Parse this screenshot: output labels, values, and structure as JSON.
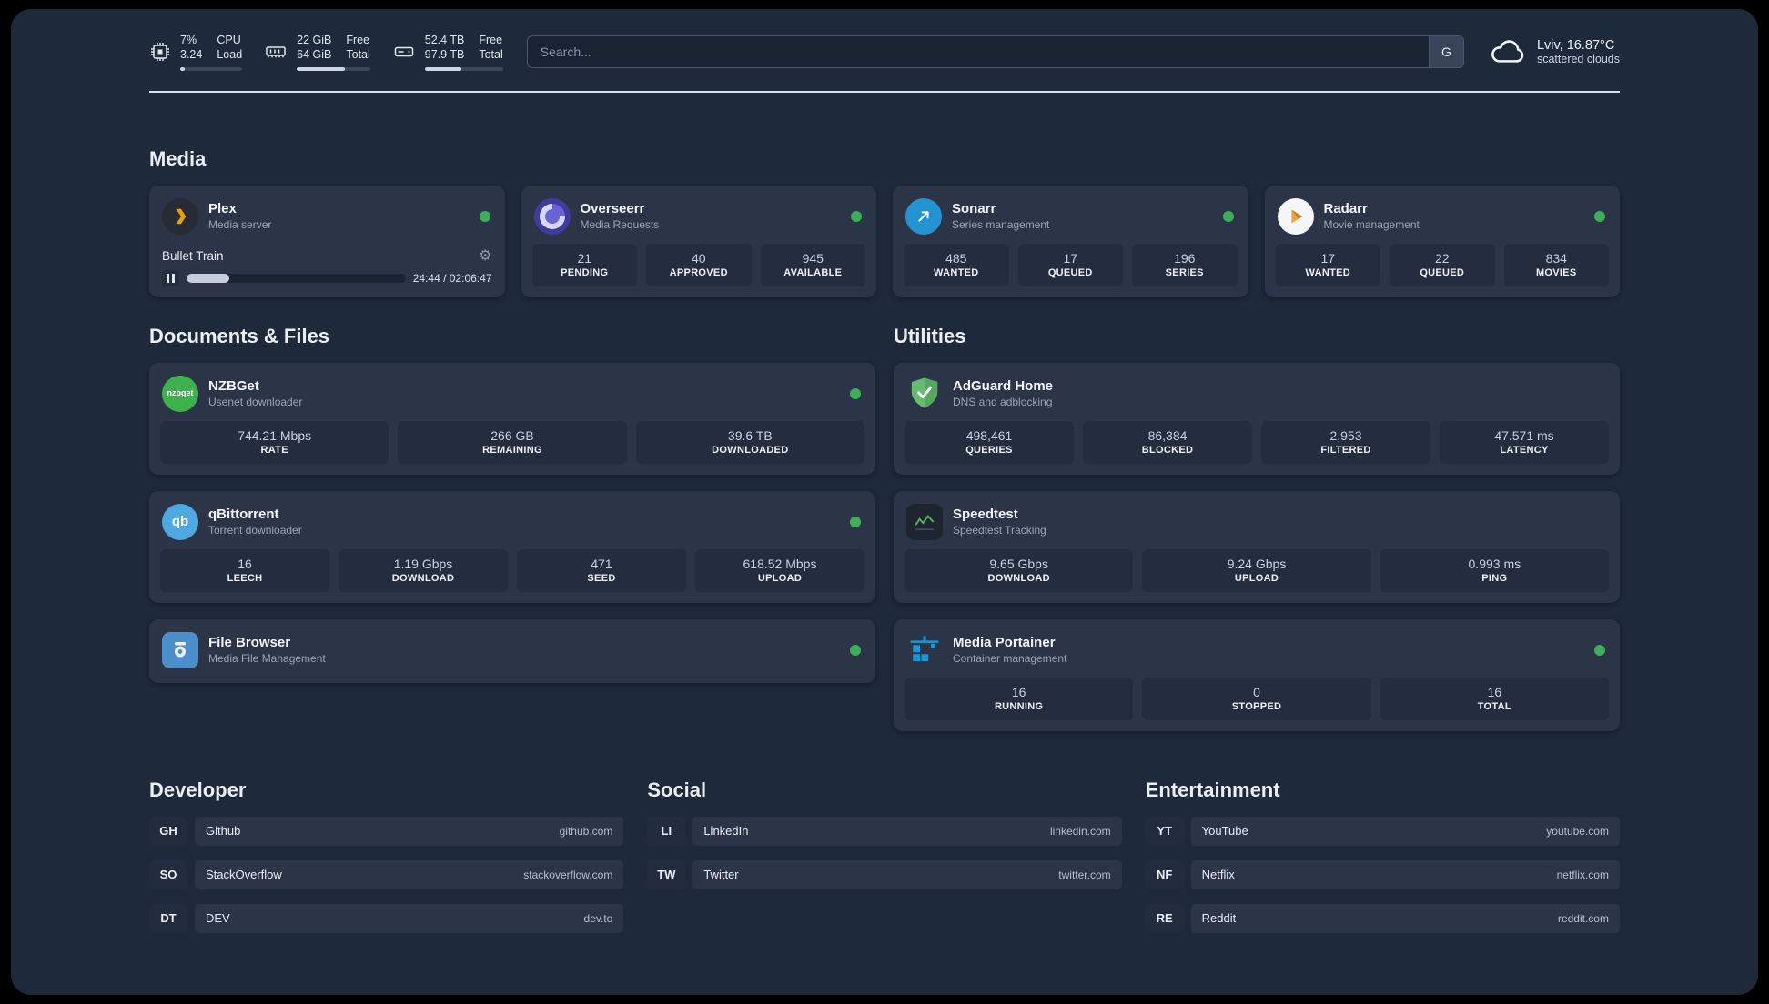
{
  "topbar": {
    "cpu": {
      "percent": "7%",
      "load": "3.24",
      "label_top": "CPU",
      "label_bottom": "Load",
      "bar_percent": 7
    },
    "ram": {
      "free": "22 GiB",
      "total": "64 GiB",
      "label_top": "Free",
      "label_bottom": "Total",
      "bar_percent": 66
    },
    "disk": {
      "free": "52.4 TB",
      "total": "97.9 TB",
      "label_top": "Free",
      "label_bottom": "Total",
      "bar_percent": 47
    },
    "search": {
      "placeholder": "Search...",
      "engine_label": "G"
    },
    "weather": {
      "location": "Lviv, 16.87°C",
      "condition": "scattered clouds"
    }
  },
  "sections": {
    "media": {
      "title": "Media"
    },
    "documents": {
      "title": "Documents & Files"
    },
    "utilities": {
      "title": "Utilities"
    },
    "developer": {
      "title": "Developer"
    },
    "social": {
      "title": "Social"
    },
    "entertainment": {
      "title": "Entertainment"
    }
  },
  "apps": {
    "plex": {
      "name": "Plex",
      "subtitle": "Media server",
      "player": {
        "title": "Bullet Train",
        "time": "24:44 / 02:06:47",
        "progress_percent": 19.5
      }
    },
    "overseerr": {
      "name": "Overseerr",
      "subtitle": "Media Requests",
      "stats": [
        {
          "value": "21",
          "label": "PENDING"
        },
        {
          "value": "40",
          "label": "APPROVED"
        },
        {
          "value": "945",
          "label": "AVAILABLE"
        }
      ]
    },
    "sonarr": {
      "name": "Sonarr",
      "subtitle": "Series management",
      "stats": [
        {
          "value": "485",
          "label": "WANTED"
        },
        {
          "value": "17",
          "label": "QUEUED"
        },
        {
          "value": "196",
          "label": "SERIES"
        }
      ]
    },
    "radarr": {
      "name": "Radarr",
      "subtitle": "Movie management",
      "stats": [
        {
          "value": "17",
          "label": "WANTED"
        },
        {
          "value": "22",
          "label": "QUEUED"
        },
        {
          "value": "834",
          "label": "MOVIES"
        }
      ]
    },
    "nzbget": {
      "name": "NZBGet",
      "subtitle": "Usenet downloader",
      "icon_text": "nzbget",
      "stats": [
        {
          "value": "744.21 Mbps",
          "label": "RATE"
        },
        {
          "value": "266 GB",
          "label": "REMAINING"
        },
        {
          "value": "39.6 TB",
          "label": "DOWNLOADED"
        }
      ]
    },
    "qbittorrent": {
      "name": "qBittorrent",
      "subtitle": "Torrent downloader",
      "icon_text": "qb",
      "stats": [
        {
          "value": "16",
          "label": "LEECH"
        },
        {
          "value": "1.19 Gbps",
          "label": "DOWNLOAD"
        },
        {
          "value": "471",
          "label": "SEED"
        },
        {
          "value": "618.52 Mbps",
          "label": "UPLOAD"
        }
      ]
    },
    "filebrowser": {
      "name": "File Browser",
      "subtitle": "Media File Management"
    },
    "adguard": {
      "name": "AdGuard Home",
      "subtitle": "DNS and adblocking",
      "stats": [
        {
          "value": "498,461",
          "label": "QUERIES"
        },
        {
          "value": "86,384",
          "label": "BLOCKED"
        },
        {
          "value": "2,953",
          "label": "FILTERED"
        },
        {
          "value": "47.571 ms",
          "label": "LATENCY"
        }
      ]
    },
    "speedtest": {
      "name": "Speedtest",
      "subtitle": "Speedtest Tracking",
      "stats": [
        {
          "value": "9.65 Gbps",
          "label": "DOWNLOAD"
        },
        {
          "value": "9.24 Gbps",
          "label": "UPLOAD"
        },
        {
          "value": "0.993 ms",
          "label": "PING"
        }
      ]
    },
    "portainer": {
      "name": "Media Portainer",
      "subtitle": "Container management",
      "stats": [
        {
          "value": "16",
          "label": "RUNNING"
        },
        {
          "value": "0",
          "label": "STOPPED"
        },
        {
          "value": "16",
          "label": "TOTAL"
        }
      ]
    }
  },
  "links": {
    "developer": [
      {
        "abbr": "GH",
        "name": "Github",
        "domain": "github.com"
      },
      {
        "abbr": "SO",
        "name": "StackOverflow",
        "domain": "stackoverflow.com"
      },
      {
        "abbr": "DT",
        "name": "DEV",
        "domain": "dev.to"
      }
    ],
    "social": [
      {
        "abbr": "LI",
        "name": "LinkedIn",
        "domain": "linkedin.com"
      },
      {
        "abbr": "TW",
        "name": "Twitter",
        "domain": "twitter.com"
      }
    ],
    "entertainment": [
      {
        "abbr": "YT",
        "name": "YouTube",
        "domain": "youtube.com"
      },
      {
        "abbr": "NF",
        "name": "Netflix",
        "domain": "netflix.com"
      },
      {
        "abbr": "RE",
        "name": "Reddit",
        "domain": "reddit.com"
      }
    ]
  },
  "icons": {
    "gear": "⚙"
  },
  "colors": {
    "status_online": "#3fae5a",
    "plex_accent": "#e5a00d",
    "sonarr_blue": "#2493d1",
    "radarr_orange": "#f2a33c",
    "overseerr_purple": "#6963d8",
    "nzbget_green": "#3db14d",
    "qbittorrent_blue": "#4fa9e0",
    "filebrowser_blue": "#4c8fca",
    "adguard_green": "#68bc71",
    "speedtest_green": "#53b554",
    "portainer_blue": "#1899d6"
  }
}
